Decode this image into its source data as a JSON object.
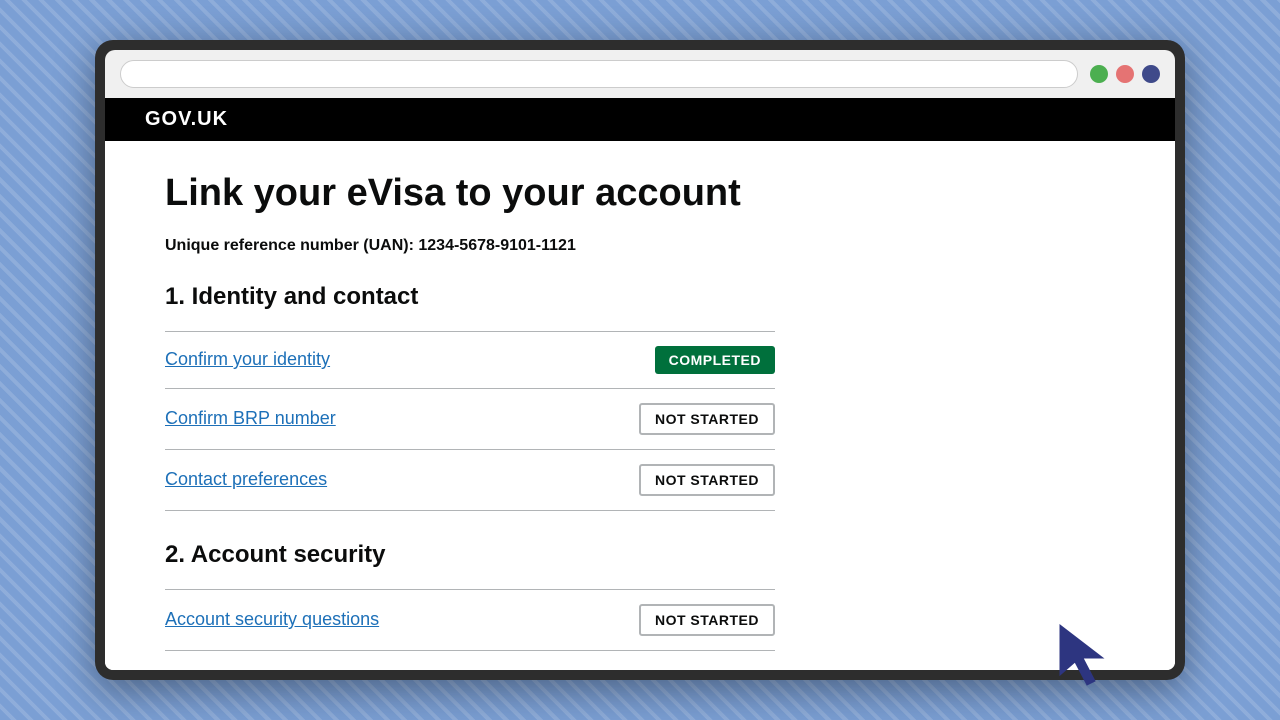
{
  "browser": {
    "dots": {
      "green": "#4caf50",
      "red": "#e57373",
      "blue": "#3f4a8a"
    }
  },
  "header": {
    "logo": "GOV.UK"
  },
  "page": {
    "title": "Link your eVisa to your account",
    "uan_label": "Unique reference number (UAN): 1234-5678-9101-1121",
    "section1_heading": "1. Identity and contact",
    "section2_heading": "2. Account security",
    "tasks": [
      {
        "label": "Confirm your identity",
        "status": "COMPLETED",
        "status_type": "completed"
      },
      {
        "label": "Confirm BRP number",
        "status": "NOT STARTED",
        "status_type": "not-started"
      },
      {
        "label": "Contact preferences",
        "status": "NOT STARTED",
        "status_type": "not-started"
      }
    ],
    "section2_tasks": [
      {
        "label": "Account security questions",
        "status": "NOT STARTED",
        "status_type": "not-started"
      }
    ],
    "status_labels": {
      "completed": "COMPLETED",
      "not_started": "NOT STARTED"
    }
  }
}
